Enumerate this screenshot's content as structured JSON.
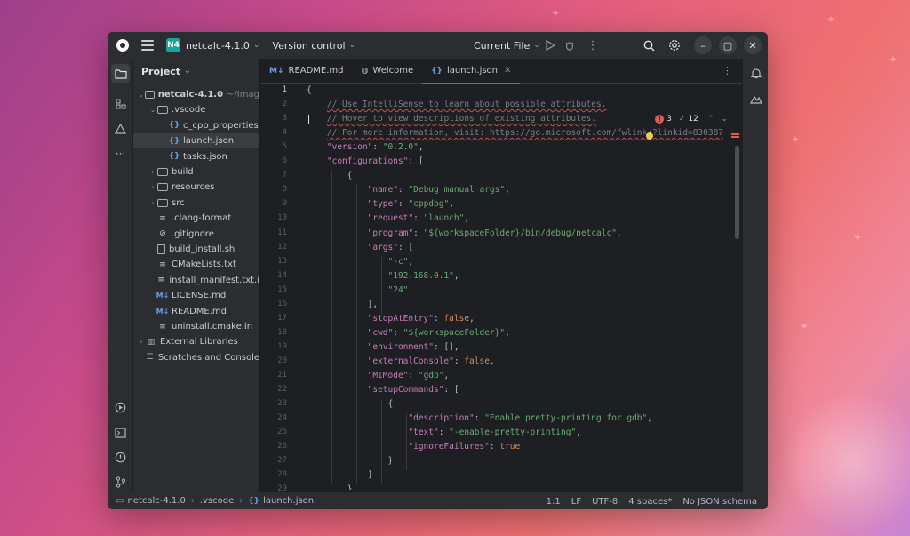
{
  "titlebar": {
    "project_badge": "N4",
    "project_name": "netcalc-4.1.0",
    "vcs_label": "Version control",
    "run_config": "Current File"
  },
  "project_panel": {
    "title": "Project",
    "tree": [
      {
        "label": "netcalc-4.1.0",
        "hint": "~/Imag",
        "icon": "folder-icon",
        "depth": 0,
        "expanded": true
      },
      {
        "label": ".vscode",
        "icon": "folder-icon",
        "depth": 1,
        "expanded": true
      },
      {
        "label": "c_cpp_properties",
        "icon": "json-icon",
        "depth": 2
      },
      {
        "label": "launch.json",
        "icon": "json-icon",
        "depth": 2,
        "selected": true
      },
      {
        "label": "tasks.json",
        "icon": "json-icon",
        "depth": 2
      },
      {
        "label": "build",
        "icon": "folder-icon",
        "depth": 1,
        "expanded": false
      },
      {
        "label": "resources",
        "icon": "folder-icon",
        "depth": 1,
        "expanded": false
      },
      {
        "label": "src",
        "icon": "folder-icon",
        "depth": 1,
        "expanded": false
      },
      {
        "label": ".clang-format",
        "icon": "config-file-icon",
        "depth": 1
      },
      {
        "label": ".gitignore",
        "icon": "gitignore-icon",
        "depth": 1
      },
      {
        "label": "build_install.sh",
        "icon": "file-icon",
        "depth": 1
      },
      {
        "label": "CMakeLists.txt",
        "icon": "config-file-icon",
        "depth": 1
      },
      {
        "label": "install_manifest.txt.i",
        "icon": "config-file-icon",
        "depth": 1
      },
      {
        "label": "LICENSE.md",
        "icon": "markdown-icon",
        "depth": 1
      },
      {
        "label": "README.md",
        "icon": "markdown-icon",
        "depth": 1
      },
      {
        "label": "uninstall.cmake.in",
        "icon": "config-file-icon",
        "depth": 1
      },
      {
        "label": "External Libraries",
        "icon": "library-icon",
        "depth": 0,
        "expanded": false
      },
      {
        "label": "Scratches and Console",
        "icon": "scratches-icon",
        "depth": 0
      }
    ]
  },
  "editor": {
    "tabs": [
      {
        "label": "README.md",
        "icon": "M↓",
        "active": false,
        "closable": false
      },
      {
        "label": "Welcome",
        "icon": "globe-icon",
        "active": false,
        "closable": false
      },
      {
        "label": "launch.json",
        "icon": "{}",
        "active": true,
        "closable": true
      }
    ],
    "inspection": {
      "errors": "3",
      "warnings": "12"
    },
    "line_numbers": [
      "1",
      "2",
      "3",
      "4",
      "5",
      "6",
      "7",
      "8",
      "9",
      "10",
      "11",
      "12",
      "13",
      "14",
      "15",
      "16",
      "17",
      "18",
      "19",
      "20",
      "21",
      "22",
      "23",
      "24",
      "25",
      "26",
      "27",
      "28",
      "29"
    ],
    "lines": [
      "{",
      "    // Use IntelliSense to learn about possible attributes.",
      "    // Hover to view descriptions of existing attributes.",
      "    // For more information, visit: https://go.microsoft.com/fwlink/?linkid=830387",
      "    \"version\": \"0.2.0\",",
      "    \"configurations\": [",
      "        {",
      "            \"name\": \"Debug manual args\",",
      "            \"type\": \"cppdbg\",",
      "            \"request\": \"launch\",",
      "            \"program\": \"${workspaceFolder}/bin/debug/netcalc\",",
      "            \"args\": [",
      "                \"-c\",",
      "                \"192.168.0.1\",",
      "                \"24\"",
      "            ],",
      "            \"stopAtEntry\": false,",
      "            \"cwd\": \"${workspaceFolder}\",",
      "            \"environment\": [],",
      "            \"externalConsole\": false,",
      "            \"MIMode\": \"gdb\",",
      "            \"setupCommands\": [",
      "                {",
      "                    \"description\": \"Enable pretty-printing for gdb\",",
      "                    \"text\": \"-enable-pretty-printing\",",
      "                    \"ignoreFailures\": true",
      "                }",
      "            ]",
      "        }"
    ]
  },
  "statusbar": {
    "crumbs": [
      "netcalc-4.1.0",
      ".vscode",
      "launch.json"
    ],
    "position": "1:1",
    "line_sep": "LF",
    "encoding": "UTF-8",
    "indent": "4 spaces*",
    "schema": "No JSON schema"
  },
  "colors": {
    "accent": "#3574f0",
    "project_badge": "#1aa39a",
    "error": "#db5c5c",
    "string": "#6aab73",
    "key": "#c77dbb",
    "keyword": "#cf8e6d"
  }
}
